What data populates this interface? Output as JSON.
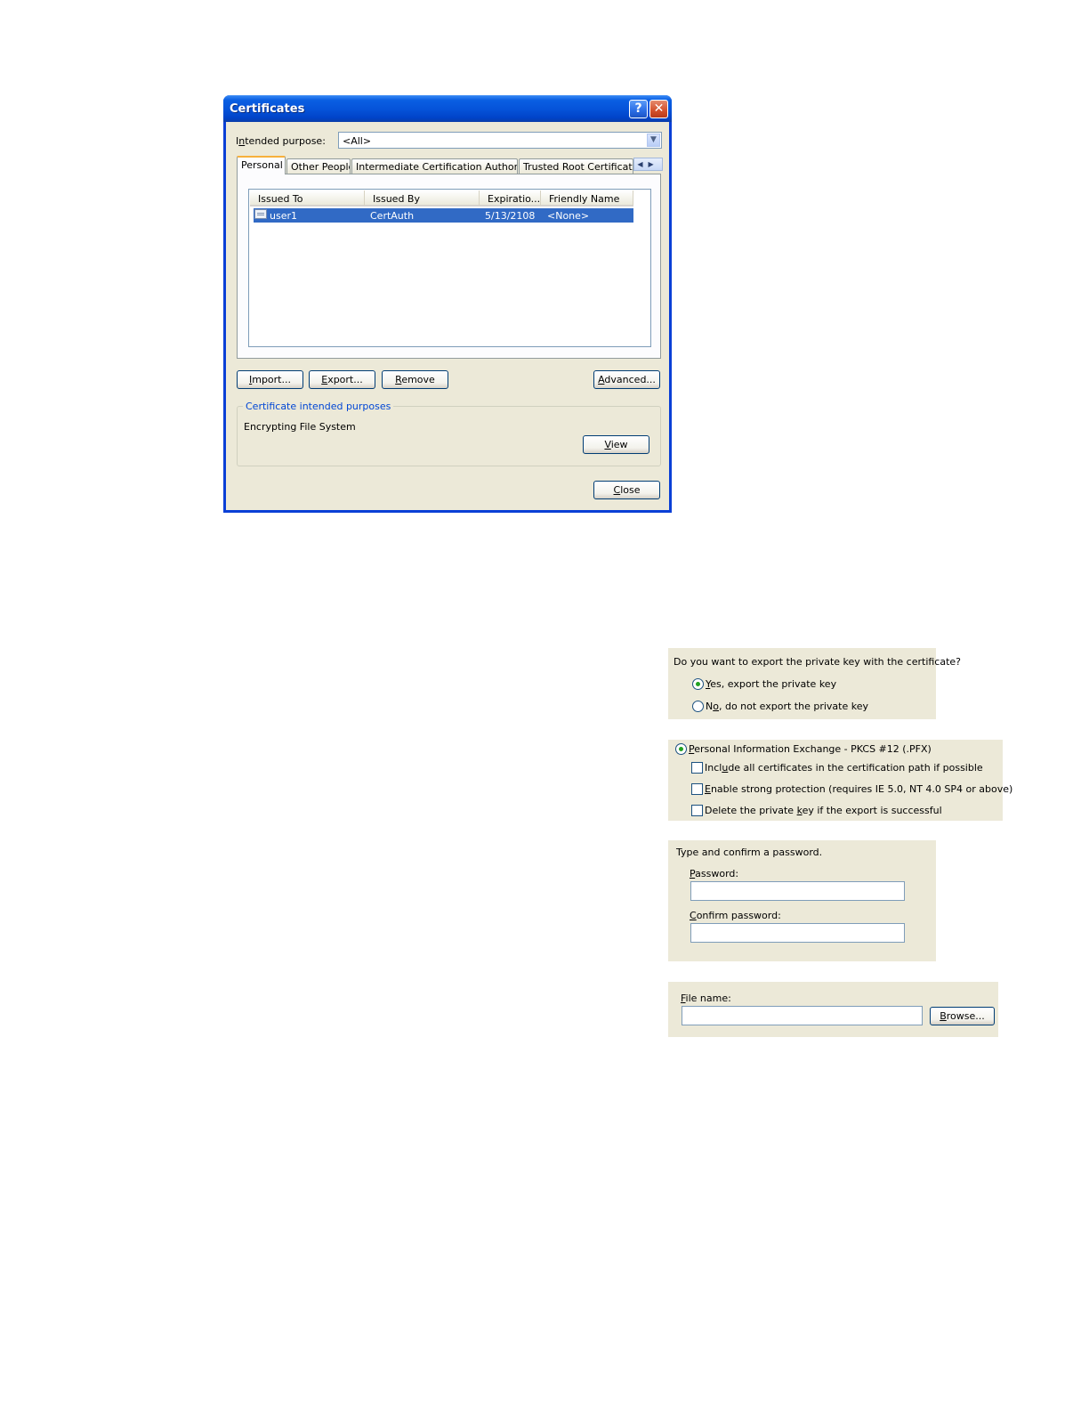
{
  "dialog": {
    "title": "Certificates",
    "help_glyph": "?",
    "close_glyph": "✕",
    "intended_purpose": {
      "label_pre": "I",
      "label_key": "n",
      "label_post": "tended purpose:",
      "value": "<All>"
    },
    "tabs": [
      {
        "label": "Personal"
      },
      {
        "label": "Other People"
      },
      {
        "label": "Intermediate Certification Authorities"
      },
      {
        "label": "Trusted Root Certification Authorities"
      }
    ],
    "tab_scroll_glyphs": "◀▶",
    "columns": [
      "Issued To",
      "Issued By",
      "Expiratio...",
      "Friendly Name"
    ],
    "rows": [
      {
        "issued_to": "user1",
        "issued_by": "CertAuth",
        "expiration": "5/13/2108",
        "friendly_name": "<None>"
      }
    ],
    "buttons": {
      "import": {
        "key": "I",
        "rest": "mport..."
      },
      "export": {
        "key": "E",
        "rest": "xport..."
      },
      "remove": {
        "key": "R",
        "rest": "emove"
      },
      "advanced": {
        "key": "A",
        "rest": "dvanced..."
      },
      "view": {
        "key": "V",
        "rest": "iew"
      },
      "close": {
        "key": "C",
        "rest": "lose"
      }
    },
    "purposes_group": {
      "legend": "Certificate intended purposes",
      "value": "Encrypting File System"
    }
  },
  "export_private_key": {
    "question": "Do you want to export the private key with the certificate?",
    "options": [
      {
        "key": "Y",
        "rest": "es, export the private key",
        "selected": true
      },
      {
        "pre": "N",
        "key": "o",
        "rest": ", do not export the private key",
        "selected": false
      }
    ]
  },
  "pfx_format": {
    "radio": {
      "key": "P",
      "rest": "ersonal Information Exchange - PKCS #12 (.PFX)",
      "selected": true
    },
    "checkboxes": [
      {
        "pre": "Incl",
        "key": "u",
        "rest": "de all certificates in the certification path if possible",
        "checked": false
      },
      {
        "pre": "",
        "key": "E",
        "rest": "nable strong protection (requires IE 5.0, NT 4.0 SP4 or above)",
        "checked": false
      },
      {
        "pre": "Delete the private ",
        "key": "k",
        "rest": "ey if the export is successful",
        "checked": false
      }
    ]
  },
  "password": {
    "prompt": "Type and confirm a password.",
    "password_label": {
      "key": "P",
      "rest": "assword:"
    },
    "password_value": "",
    "confirm_label": {
      "key": "C",
      "rest": "onfirm password:"
    },
    "confirm_value": ""
  },
  "file": {
    "label": {
      "key": "F",
      "rest": "ile name:"
    },
    "value": "",
    "browse": {
      "key": "B",
      "rest": "rowse..."
    }
  }
}
